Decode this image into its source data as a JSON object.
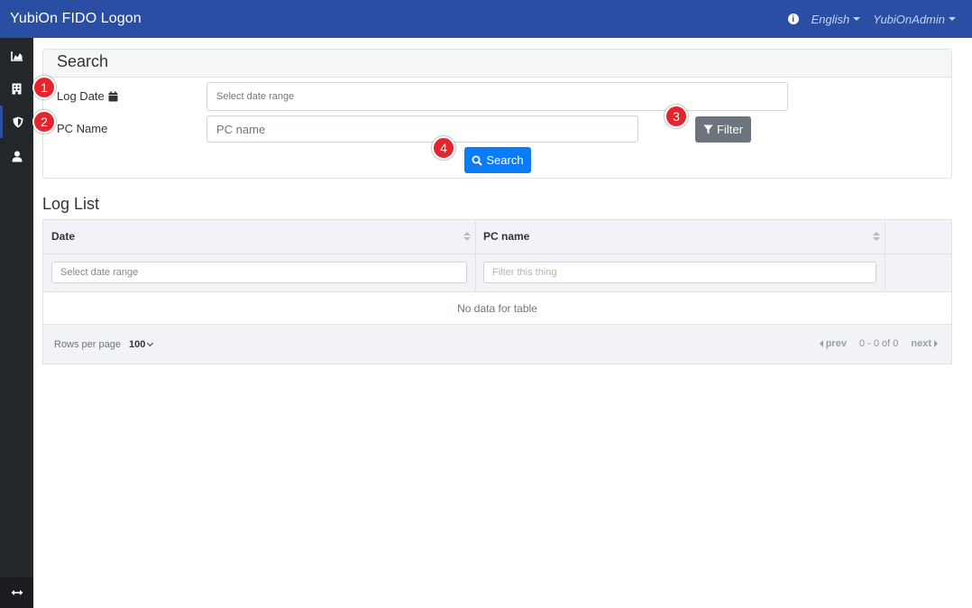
{
  "app": {
    "title": "YubiOn FIDO Logon"
  },
  "navbar": {
    "info_icon": "info-circle-icon",
    "language": "English",
    "user": "YubiOnAdmin"
  },
  "sidebar": {
    "items": [
      {
        "icon": "chart-area-icon"
      },
      {
        "icon": "building-icon"
      },
      {
        "icon": "shield-icon",
        "active": true
      },
      {
        "icon": "user-icon"
      }
    ],
    "toggle_icon": "arrows-horizontal-icon"
  },
  "search": {
    "title": "Search",
    "log_date_label": "Log Date",
    "log_date_placeholder": "Select date range",
    "pc_name_label": "PC Name",
    "pc_name_placeholder": "PC name",
    "filter_label": "Filter",
    "search_label": "Search"
  },
  "markers": [
    "1",
    "2",
    "3",
    "4"
  ],
  "log_list": {
    "title": "Log List",
    "columns": [
      "Date",
      "PC name"
    ],
    "date_filter_placeholder": "Select date range",
    "pc_filter_placeholder": "Filter this thing",
    "empty_text": "No data for table",
    "rows_per_page_label": "Rows per page",
    "rows_per_page": "100",
    "prev": "prev",
    "range": "0 - 0 of 0",
    "next": "next"
  },
  "colors": {
    "navbar": "#2a4ea3",
    "sidebar": "#23262b",
    "primary_button": "#0b7cf5",
    "secondary_button": "#6c757d",
    "marker": "#e3262d"
  }
}
